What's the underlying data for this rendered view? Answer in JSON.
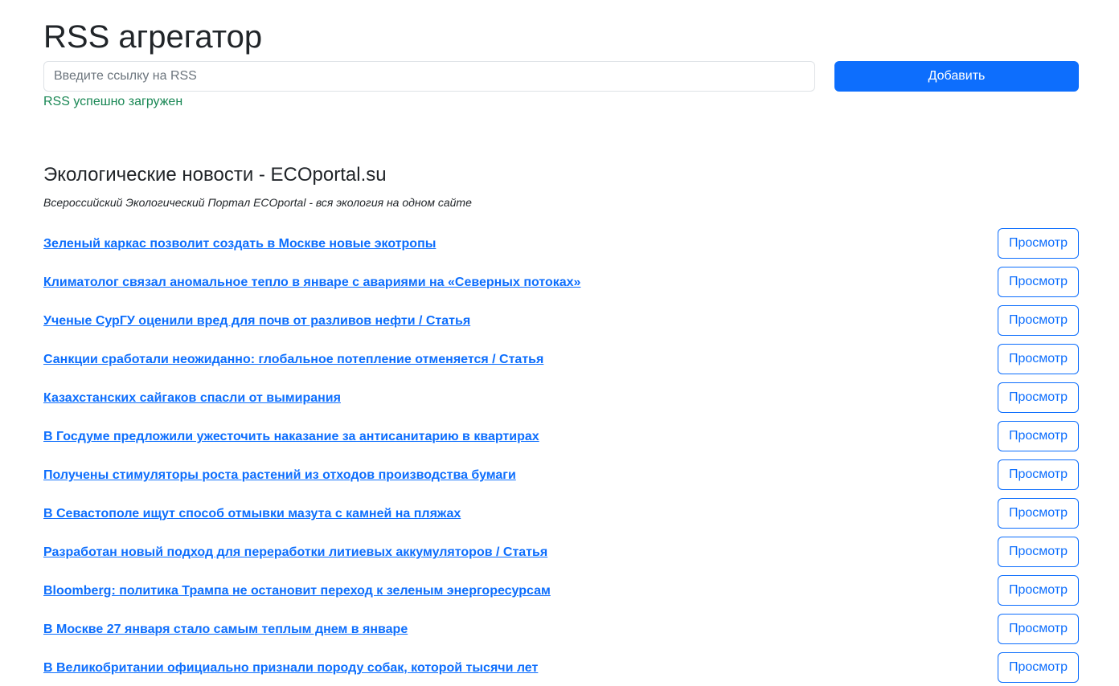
{
  "header": {
    "title": "RSS агрегатор"
  },
  "form": {
    "input_placeholder": "Введите ссылку на RSS",
    "input_value": "",
    "add_label": "Добавить",
    "feedback": "RSS успешно загружен"
  },
  "colors": {
    "primary": "#0d6efd",
    "success": "#198754",
    "text": "#212529",
    "border": "#dee2e6"
  },
  "feed": {
    "title": "Экологические новости - ECOportal.su",
    "description": "Всероссийский Экологический Портал ECOportal - вся экология на одном сайте"
  },
  "posts": [
    {
      "title": "Зеленый каркас позволит создать в Москве новые экотропы",
      "button": "Просмотр"
    },
    {
      "title": "Климатолог связал аномальное тепло в январе с авариями на «Северных потоках»",
      "button": "Просмотр"
    },
    {
      "title": "Ученые СурГУ оценили вред для почв от разливов нефти / Статья",
      "button": "Просмотр"
    },
    {
      "title": "Санкции сработали неожиданно: глобальное потепление отменяется / Статья",
      "button": "Просмотр"
    },
    {
      "title": "Казахстанских сайгаков спасли от вымирания",
      "button": "Просмотр"
    },
    {
      "title": "В Госдуме предложили ужесточить наказание за антисанитарию в квартирах",
      "button": "Просмотр"
    },
    {
      "title": "Получены стимуляторы роста растений из отходов производства бумаги",
      "button": "Просмотр"
    },
    {
      "title": "В Севастополе ищут способ отмывки мазута с камней на пляжах",
      "button": "Просмотр"
    },
    {
      "title": "Разработан новый подход для переработки литиевых аккумуляторов / Статья",
      "button": "Просмотр"
    },
    {
      "title": "Bloomberg: политика Трампа не остановит переход к зеленым энергоресурсам",
      "button": "Просмотр"
    },
    {
      "title": "В Москве 27 января стало самым теплым днем в январе",
      "button": "Просмотр"
    },
    {
      "title": "В Великобритании официально признали породу собак, которой тысячи лет",
      "button": "Просмотр"
    }
  ]
}
